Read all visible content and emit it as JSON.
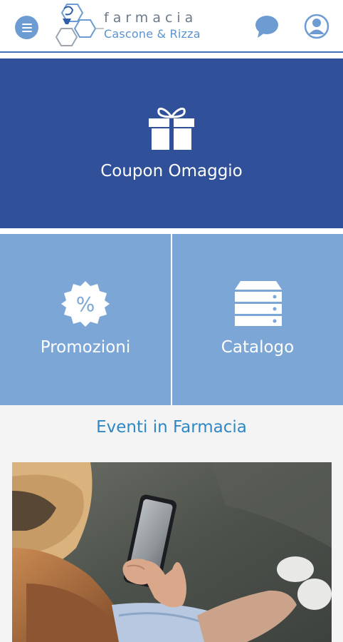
{
  "header": {
    "logo_line1": "farmacia",
    "logo_line2": "Cascone & Rizza",
    "icons": {
      "menu": "menu-icon",
      "chat": "chat-icon",
      "account": "account-icon"
    }
  },
  "tiles": {
    "coupon": {
      "label": "Coupon Omaggio",
      "icon": "gift-icon"
    },
    "promotions": {
      "label": "Promozioni",
      "icon": "percent-badge-icon"
    },
    "catalog": {
      "label": "Catalogo",
      "icon": "drawers-icon"
    }
  },
  "events": {
    "title": "Eventi in Farmacia"
  },
  "colors": {
    "primary": "#30509a",
    "secondary": "#7ba6d6",
    "accent": "#2f88c4",
    "icon_bg": "#6c9cd2"
  }
}
